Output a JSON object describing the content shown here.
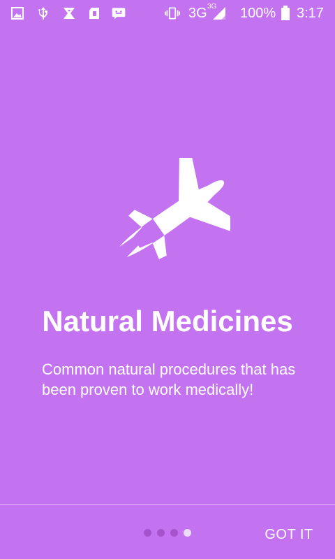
{
  "status_bar": {
    "network": "3G",
    "network_superscript": "3G",
    "battery_percent": "100%",
    "time": "3:17",
    "icons": [
      "gallery-icon",
      "usb-icon",
      "hourglass-icon",
      "sd-card-icon",
      "message-icon",
      "vibrate-icon",
      "signal-icon",
      "battery-icon"
    ]
  },
  "onboarding": {
    "illustration_icon": "airplane-icon",
    "title": "Natural Medicines",
    "description": "Common natural procedures that has been proven to work medically!",
    "page_current": 4,
    "page_total": 4
  },
  "footer": {
    "got_it_label": "GOT IT"
  },
  "colors": {
    "background": "#c473f0",
    "dot_inactive": "#a553cc",
    "dot_active": "#eadcf6",
    "text": "#ffffff"
  }
}
